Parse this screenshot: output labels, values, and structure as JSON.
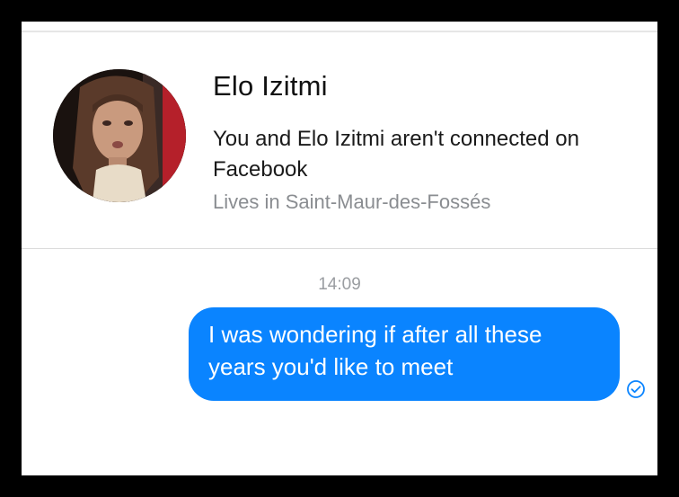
{
  "contact": {
    "name": "Elo Izitmi",
    "connection_note": "You and Elo Izitmi aren't connected on Facebook",
    "location": "Lives in Saint-Maur-des-Fossés",
    "avatar_icon": "profile-photo"
  },
  "conversation": {
    "timestamp": "14:09",
    "messages": [
      {
        "direction": "outgoing",
        "text": "I was wondering if after all these years you'd like to meet",
        "status_icon": "check-circle-icon"
      }
    ]
  },
  "colors": {
    "bubble": "#0A84FF",
    "bubble_text": "#FFFFFF",
    "frame": "#000000",
    "muted_text": "#8A8D91"
  }
}
